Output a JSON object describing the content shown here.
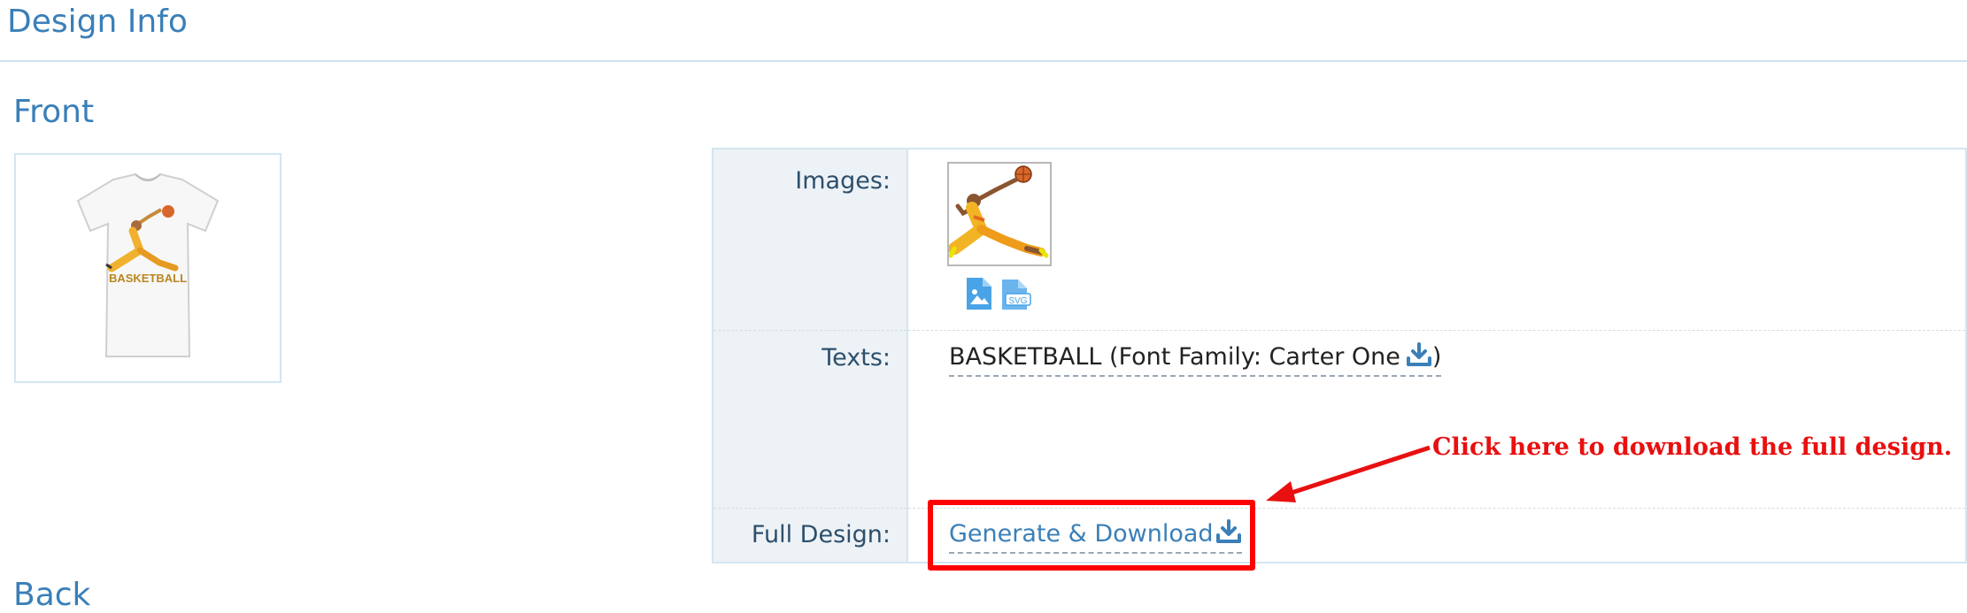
{
  "page": {
    "title": "Design Info"
  },
  "front": {
    "section_title": "Front"
  },
  "back": {
    "section_title": "Back"
  },
  "design_info": {
    "images_label": "Images:",
    "texts_label": "Texts:",
    "full_design_label": "Full Design:",
    "text_entry": "BASKETBALL (Font Family: Carter One",
    "text_entry_close": ")",
    "generate_link": "Generate & Download",
    "file_icons": [
      "image-file-icon",
      "svg-file-icon"
    ],
    "svg_badge": "SVG"
  },
  "annotation": {
    "callout": "Click here to download the full design.",
    "highlight_color": "#ff0000"
  },
  "colors": {
    "accent": "#3a7fb8",
    "label_bg": "#edf2f6",
    "border": "#d3e6f1"
  }
}
